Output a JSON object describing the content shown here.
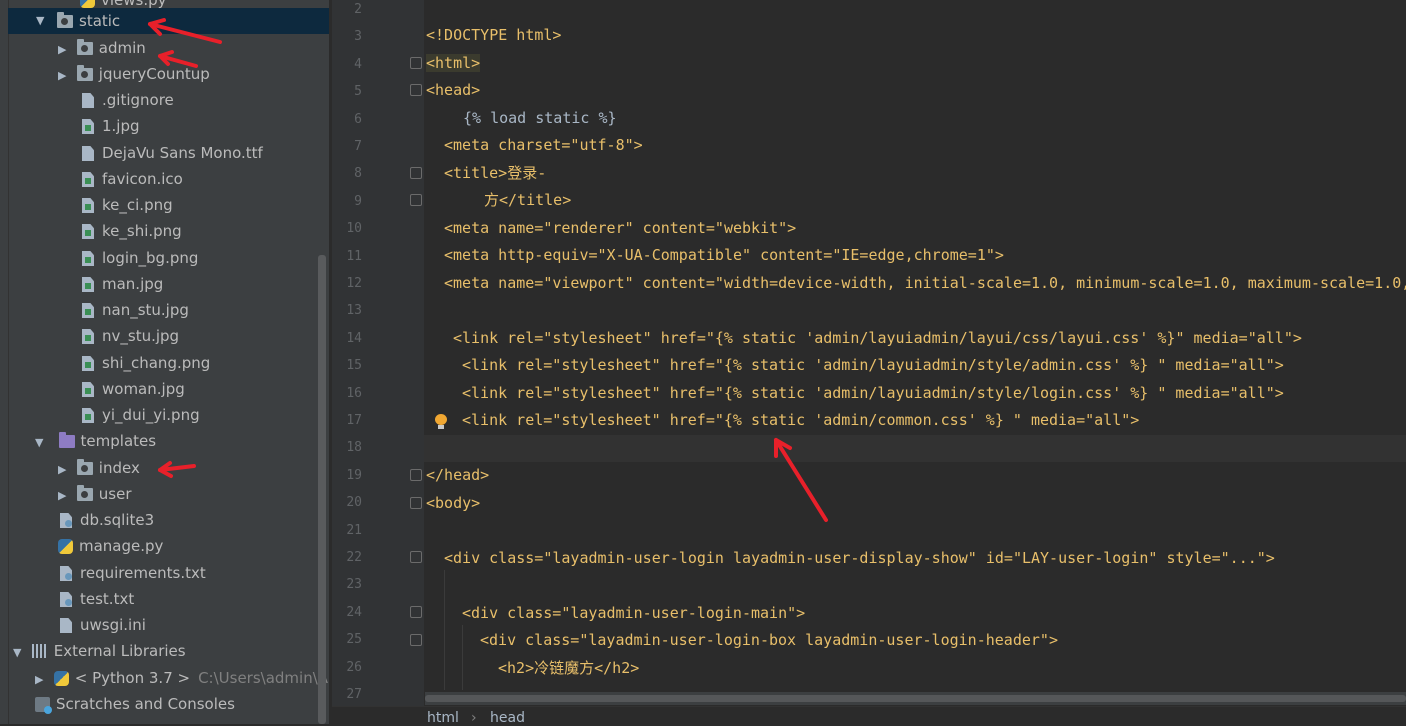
{
  "project_tree": {
    "items": [
      {
        "label": "views.py",
        "type": "py"
      },
      {
        "label": "static",
        "type": "folder",
        "expanded": true,
        "selected": true
      },
      {
        "label": "admin",
        "type": "folder"
      },
      {
        "label": "jqueryCountup",
        "type": "folder"
      },
      {
        "label": ".gitignore",
        "type": "file"
      },
      {
        "label": "1.jpg",
        "type": "image"
      },
      {
        "label": "DejaVu Sans Mono.ttf",
        "type": "file"
      },
      {
        "label": "favicon.ico",
        "type": "image"
      },
      {
        "label": "ke_ci.png",
        "type": "image"
      },
      {
        "label": "ke_shi.png",
        "type": "image"
      },
      {
        "label": "login_bg.png",
        "type": "image"
      },
      {
        "label": "man.jpg",
        "type": "image"
      },
      {
        "label": "nan_stu.jpg",
        "type": "image"
      },
      {
        "label": "nv_stu.jpg",
        "type": "image"
      },
      {
        "label": "shi_chang.png",
        "type": "image"
      },
      {
        "label": "woman.jpg",
        "type": "image"
      },
      {
        "label": "yi_dui_yi.png",
        "type": "image"
      },
      {
        "label": "templates",
        "type": "folder-purple",
        "expanded": true
      },
      {
        "label": "index",
        "type": "folder"
      },
      {
        "label": "user",
        "type": "folder"
      },
      {
        "label": "db.sqlite3",
        "type": "file"
      },
      {
        "label": "manage.py",
        "type": "py"
      },
      {
        "label": "requirements.txt",
        "type": "config"
      },
      {
        "label": "test.txt",
        "type": "config"
      },
      {
        "label": "uwsgi.ini",
        "type": "file"
      },
      {
        "label": "External Libraries",
        "type": "lib"
      },
      {
        "label": "< Python 3.7 >",
        "type": "py",
        "path": "C:\\Users\\admin\\Ap"
      },
      {
        "label": "Scratches and Consoles",
        "type": "scratch"
      }
    ]
  },
  "editor": {
    "line_numbers": [
      "2",
      "3",
      "4",
      "5",
      "6",
      "7",
      "8",
      "9",
      "10",
      "11",
      "12",
      "13",
      "14",
      "15",
      "16",
      "17",
      "18",
      "19",
      "20",
      "21",
      "22",
      "23",
      "24",
      "25",
      "26",
      "27"
    ],
    "lines": {
      "l3": "<!DOCTYPE html>",
      "l4": "<html>",
      "l5": "<head>",
      "l6": "{% load static %}",
      "l7": "<meta charset=\"utf-8\">",
      "l8": "<title>登录-",
      "l9": "方</title>",
      "l10": "<meta name=\"renderer\" content=\"webkit\">",
      "l11": "<meta http-equiv=\"X-UA-Compatible\" content=\"IE=edge,chrome=1\">",
      "l12": "<meta name=\"viewport\" content=\"width=device-width, initial-scale=1.0, minimum-scale=1.0, maximum-scale=1.0,",
      "l14": "<link rel=\"stylesheet\" href=\"{% static 'admin/layuiadmin/layui/css/layui.css' %}\" media=\"all\">",
      "l15": "<link rel=\"stylesheet\" href=\"{% static 'admin/layuiadmin/style/admin.css' %} \" media=\"all\">",
      "l16": "<link rel=\"stylesheet\" href=\"{% static 'admin/layuiadmin/style/login.css' %} \" media=\"all\">",
      "l17": "<link rel=\"stylesheet\" href=\"{% static 'admin/common.css' %} \" media=\"all\">",
      "l19": "</head>",
      "l20": "<body>",
      "l22": "<div class=\"layadmin-user-login layadmin-user-display-show\" id=\"LAY-user-login\" style=\"...\">",
      "l24": "<div class=\"layadmin-user-login-main\">",
      "l25": "<div class=\"layadmin-user-login-box layadmin-user-login-header\">",
      "l26": "<h2>冷链魔方</h2>"
    }
  },
  "breadcrumbs": [
    "html",
    "head"
  ],
  "colors": {
    "tag": "#e8bf6a",
    "string": "#a5c261",
    "text": "#a9b7c6",
    "annotation_arrow": "#e8202a",
    "selection": "#0d293e"
  }
}
